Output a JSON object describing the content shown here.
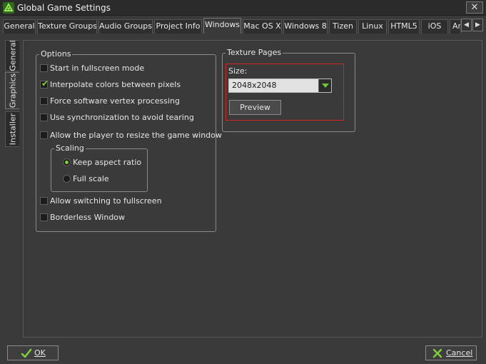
{
  "window": {
    "title": "Global Game Settings",
    "close_glyph": "✕"
  },
  "tabs": [
    {
      "label": "General"
    },
    {
      "label": "Texture Groups"
    },
    {
      "label": "Audio Groups"
    },
    {
      "label": "Project Info"
    },
    {
      "label": "Windows",
      "active": true
    },
    {
      "label": "Mac OS X"
    },
    {
      "label": "Windows 8"
    },
    {
      "label": "Tizen"
    },
    {
      "label": "Linux"
    },
    {
      "label": "HTML5"
    },
    {
      "label": "iOS"
    },
    {
      "label": "Ar"
    }
  ],
  "tab_scroll": {
    "left_glyph": "◀",
    "right_glyph": "▶"
  },
  "side_tabs": [
    {
      "label": "General"
    },
    {
      "label": "Graphics",
      "active": true
    },
    {
      "label": "Installer"
    }
  ],
  "options": {
    "title": "Options",
    "fullscreen": {
      "label": "Start in fullscreen mode",
      "checked": false
    },
    "interpolate": {
      "label": "Interpolate colors between pixels",
      "checked": true
    },
    "software_vertex": {
      "label": "Force software vertex processing",
      "checked": false
    },
    "vsync": {
      "label": "Use synchronization to avoid tearing",
      "checked": false
    },
    "resize": {
      "label": "Allow the player to resize the game window",
      "checked": false
    },
    "switch_fullscreen": {
      "label": "Allow switching to fullscreen",
      "checked": false
    },
    "borderless": {
      "label": "Borderless Window",
      "checked": false
    },
    "check_glyph": "✔"
  },
  "scaling": {
    "title": "Scaling",
    "keep_aspect": {
      "label": "Keep aspect ratio",
      "selected": true
    },
    "full_scale": {
      "label": "Full scale",
      "selected": false
    }
  },
  "texture_pages": {
    "title": "Texture Pages",
    "size_label": "Size:",
    "size_value": "2048x2048",
    "preview_label": "Preview"
  },
  "footer": {
    "ok_label": "OK",
    "cancel_label": "Cancel"
  },
  "colors": {
    "accent_green": "#7fcf3a",
    "highlight_red": "#d42424",
    "background": "#3a3a3a"
  }
}
